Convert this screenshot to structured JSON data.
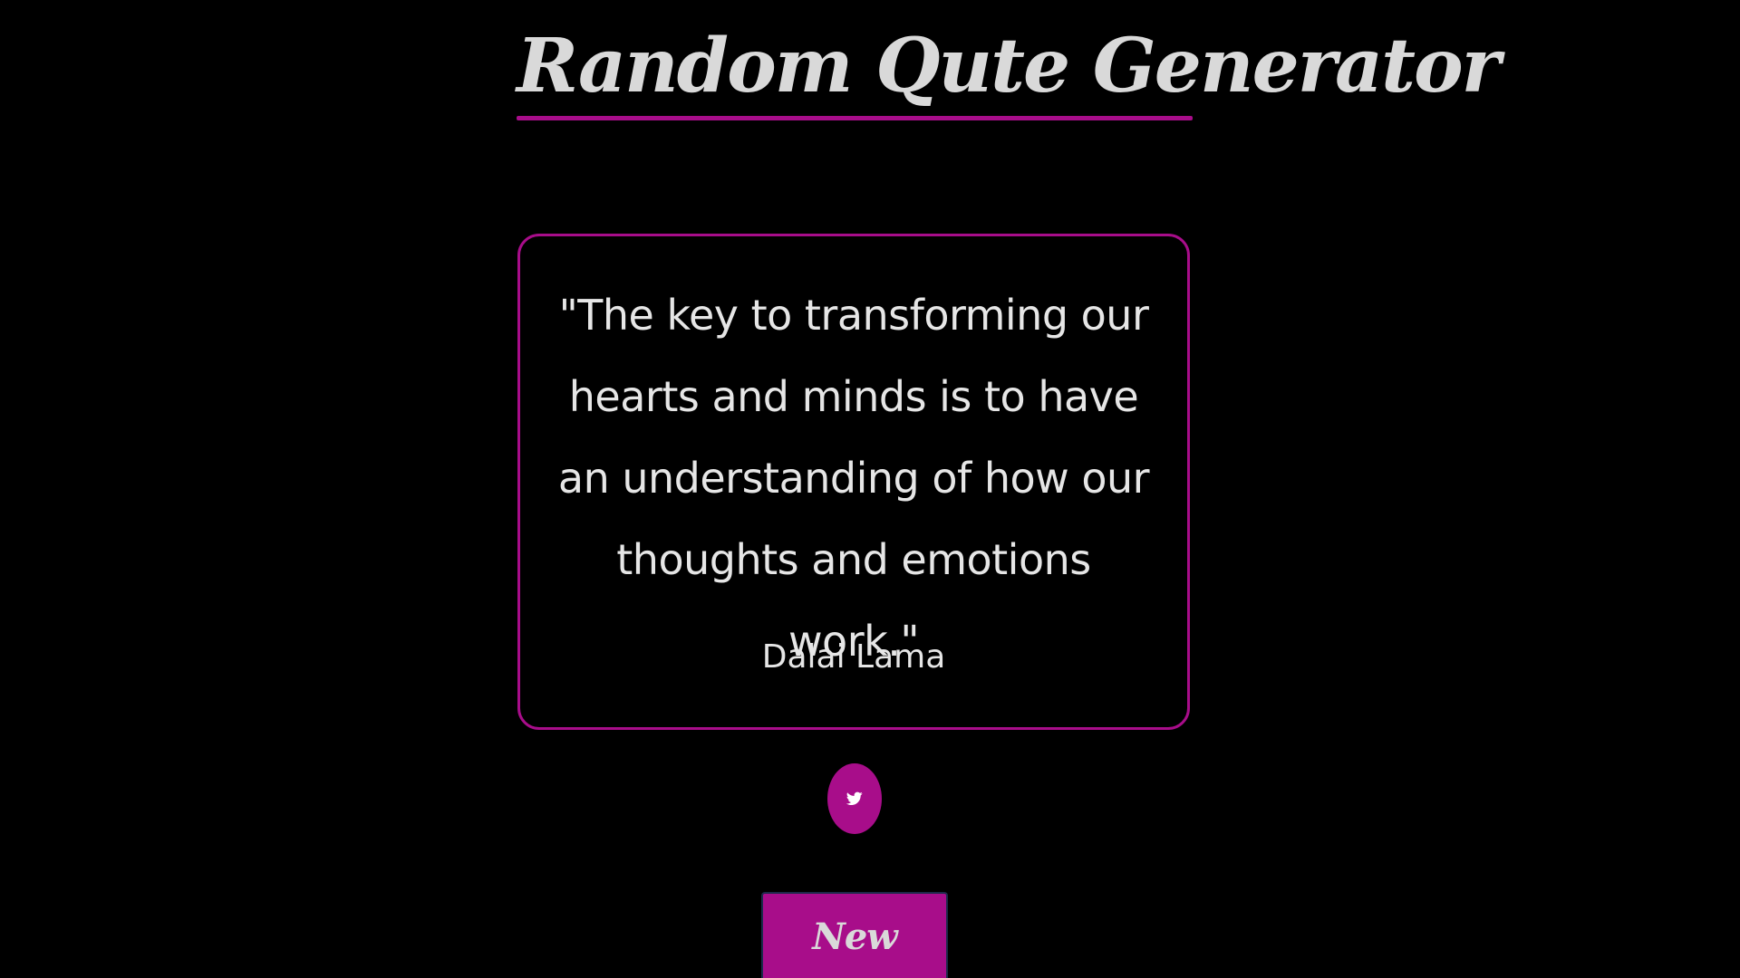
{
  "header": {
    "title": "Random Qute Generator"
  },
  "quote": {
    "text": "\"The key to transforming our hearts and minds is to have an understanding of how our thoughts and emotions work.\"",
    "author": "Dalai Lama"
  },
  "actions": {
    "tweet_icon": "twitter-bird-icon",
    "new_quote_label": "New Quote"
  },
  "colors": {
    "background": "#000000",
    "accent": "#a80d8a",
    "text": "#e6e6e6",
    "title": "#d9d9d9"
  }
}
